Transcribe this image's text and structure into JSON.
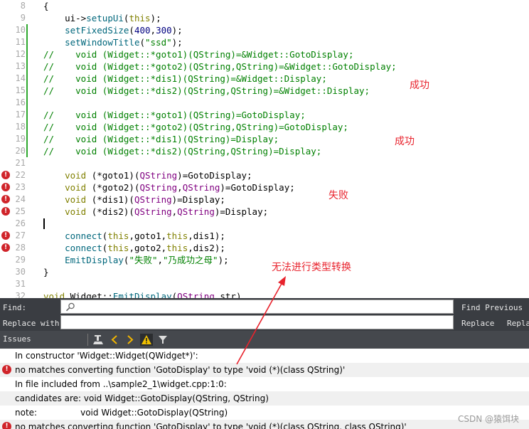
{
  "editor": {
    "lines": [
      {
        "num": "8",
        "code": "{",
        "error": false,
        "modified": false,
        "kind": "plain"
      },
      {
        "num": "9",
        "code": "    ui->setupUi(this);",
        "error": false,
        "modified": false,
        "kind": "plain"
      },
      {
        "num": "10",
        "code": "    setFixedSize(400,300);",
        "error": false,
        "modified": true,
        "kind": "plain"
      },
      {
        "num": "11",
        "code": "    setWindowTitle(\"ssd\");",
        "error": false,
        "modified": true,
        "kind": "plain"
      },
      {
        "num": "12",
        "code": "//    void (Widget::*goto1)(QString)=&Widget::GotoDisplay;",
        "error": false,
        "modified": true,
        "kind": "comment"
      },
      {
        "num": "13",
        "code": "//    void (Widget::*goto2)(QString,QString)=&Widget::GotoDisplay;",
        "error": false,
        "modified": true,
        "kind": "comment"
      },
      {
        "num": "14",
        "code": "//    void (Widget::*dis1)(QString)=&Widget::Display;",
        "error": false,
        "modified": true,
        "kind": "comment"
      },
      {
        "num": "15",
        "code": "//    void (Widget::*dis2)(QString,QString)=&Widget::Display;",
        "error": false,
        "modified": true,
        "kind": "comment"
      },
      {
        "num": "16",
        "code": "",
        "error": false,
        "modified": true,
        "kind": "plain"
      },
      {
        "num": "17",
        "code": "//    void (Widget::*goto1)(QString)=GotoDisplay;",
        "error": false,
        "modified": true,
        "kind": "comment"
      },
      {
        "num": "18",
        "code": "//    void (Widget::*goto2)(QString,QString)=GotoDisplay;",
        "error": false,
        "modified": true,
        "kind": "comment"
      },
      {
        "num": "19",
        "code": "//    void (Widget::*dis1)(QString)=Display;",
        "error": false,
        "modified": true,
        "kind": "comment"
      },
      {
        "num": "20",
        "code": "//    void (Widget::*dis2)(QString,QString)=Display;",
        "error": false,
        "modified": true,
        "kind": "comment"
      },
      {
        "num": "21",
        "code": "",
        "error": false,
        "modified": false,
        "kind": "plain"
      },
      {
        "num": "22",
        "code": "    void (*goto1)(QString)=GotoDisplay;",
        "error": true,
        "modified": false,
        "kind": "plain"
      },
      {
        "num": "23",
        "code": "    void (*goto2)(QString,QString)=GotoDisplay;",
        "error": true,
        "modified": false,
        "kind": "plain"
      },
      {
        "num": "24",
        "code": "    void (*dis1)(QString)=Display;",
        "error": true,
        "modified": false,
        "kind": "plain"
      },
      {
        "num": "25",
        "code": "    void (*dis2)(QString,QString)=Display;",
        "error": true,
        "modified": false,
        "kind": "plain"
      },
      {
        "num": "26",
        "code": "",
        "error": false,
        "modified": false,
        "kind": "caret"
      },
      {
        "num": "27",
        "code": "    connect(this,goto1,this,dis1);",
        "error": true,
        "modified": false,
        "kind": "plain"
      },
      {
        "num": "28",
        "code": "    connect(this,goto2,this,dis2);",
        "error": true,
        "modified": false,
        "kind": "plain"
      },
      {
        "num": "29",
        "code": "    EmitDisplay(\"失败\",\"乃成功之母\");",
        "error": false,
        "modified": false,
        "kind": "plain"
      },
      {
        "num": "30",
        "code": "}",
        "error": false,
        "modified": false,
        "kind": "plain"
      },
      {
        "num": "31",
        "code": "",
        "error": false,
        "modified": false,
        "kind": "plain"
      },
      {
        "num": "32",
        "code": "void Widget::EmitDisplay(QString str)",
        "error": false,
        "modified": false,
        "kind": "plain"
      }
    ],
    "error_mark": "!"
  },
  "annotations": {
    "success_1": "成功",
    "success_2": "成功",
    "failure": "失败",
    "cannot_convert": "无法进行类型转换",
    "color": "#e8232d"
  },
  "findbar": {
    "find_label": "Find:",
    "replace_label": "Replace with:",
    "find_value": "",
    "replace_value": "",
    "find_previous": "Find Previous",
    "replace": "Replace",
    "replace_all": "Repla"
  },
  "issues": {
    "title": "Issues",
    "items": [
      {
        "text": "In constructor 'Widget::Widget(QWidget*)':",
        "error": false
      },
      {
        "text": "no matches converting function 'GotoDisplay' to type 'void (*)(class QString)'",
        "error": true
      },
      {
        "text": "In file included from ..\\sample2_1\\widget.cpp:1:0:",
        "error": false
      },
      {
        "text": "candidates are: void Widget::GotoDisplay(QString, QString)",
        "error": false
      },
      {
        "text": "note:                void Widget::GotoDisplay(QString)",
        "error": false
      },
      {
        "text": "no matches converting function 'GotoDisplay' to type 'void (*)(class QString, class QString)'",
        "error": true
      }
    ]
  },
  "watermark": "CSDN @猿饵块",
  "colors": {
    "error_red": "#d0242a",
    "modified_green": "#2fa82f",
    "panel_dark": "#3a3d42"
  }
}
